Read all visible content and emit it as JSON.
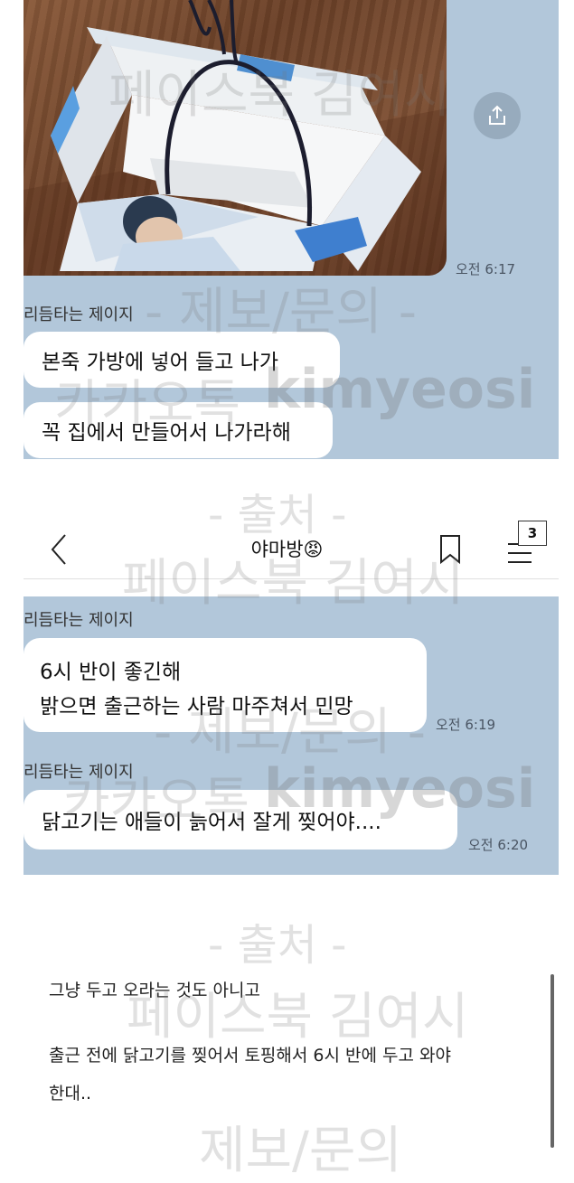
{
  "top_chat": {
    "photo_time": "오전 6:17",
    "sender": "리듬타는 제이지",
    "messages": [
      "본죽 가방에 넣어 들고 나가",
      "꼭 집에서 만들어서 나가라해"
    ],
    "share_icon": "share-icon"
  },
  "header": {
    "title": "야마방",
    "emoji": "😡",
    "badge": "3",
    "back_icon": "chevron-left-icon",
    "bookmark_icon": "bookmark-icon",
    "menu_icon": "menu-icon"
  },
  "bottom_chat": {
    "sender_1": "리듬타는 제이지",
    "message_1_line1": "6시 반이 좋긴해",
    "message_1_line2": "밝으면 출근하는 사람 마주쳐서 민망",
    "time_1": "오전 6:19",
    "sender_2": "리듬타는 제이지",
    "message_2": "닭고기는 애들이 늙어서 잘게 찢어야....",
    "time_2": "오전 6:20"
  },
  "post": {
    "line1": "그냥 두고 오라는 것도 아니고",
    "line2": "출근 전에 닭고기를 찢어서 토핑해서 6시 반에 두고 와야",
    "line3": "한대.."
  },
  "watermarks": {
    "w1": "페이스북 김여시",
    "w2": "- 제보/문의 -",
    "w3": "카카오톡",
    "w4": "kimyeosi",
    "w5": "- 출처 -",
    "w6": "페이스북 김여시",
    "w7": "- 제보/문의 -",
    "w8": "카카오톡",
    "w9": "kimyeosi",
    "w10": "- 출처 -",
    "w11": "페이스북 김여시",
    "w12": "제보/문의"
  }
}
